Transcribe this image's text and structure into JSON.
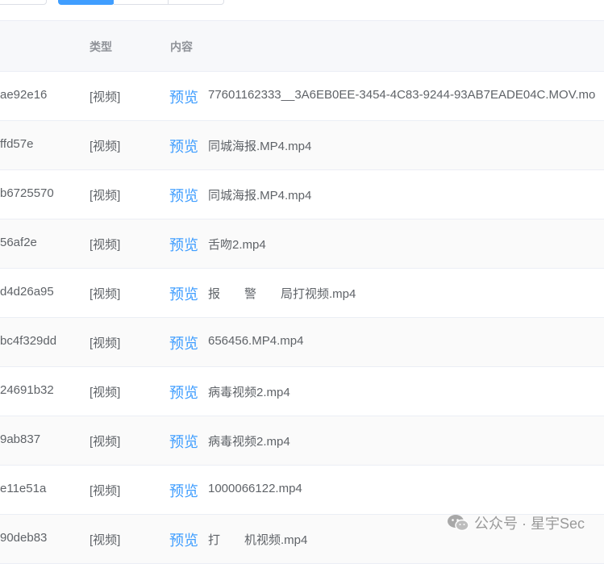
{
  "table": {
    "headers": {
      "type": "类型",
      "content": "内容"
    },
    "preview_label": "预览",
    "rows": [
      {
        "id": "ae92e16",
        "type": "[视频]",
        "file": "77601162333__3A6EB0EE-3454-4C83-9244-93AB7EADE04C.MOV.mo"
      },
      {
        "id": "ffd57e",
        "type": "[视频]",
        "file": "同城海报.MP4.mp4"
      },
      {
        "id": "b6725570",
        "type": "[视频]",
        "file": "同城海报.MP4.mp4"
      },
      {
        "id": "56af2e",
        "type": "[视频]",
        "file": "舌吻2.mp4"
      },
      {
        "id": "d4d26a95",
        "type": "[视频]",
        "file": "报　　警　　局打视频.mp4"
      },
      {
        "id": "bc4f329dd",
        "type": "[视频]",
        "file": "656456.MP4.mp4"
      },
      {
        "id": "24691b32",
        "type": "[视频]",
        "file": "病毒视频2.mp4"
      },
      {
        "id": "9ab837",
        "type": "[视频]",
        "file": "病毒视频2.mp4"
      },
      {
        "id": "e11e51a",
        "type": "[视频]",
        "file": "1000066122.mp4"
      },
      {
        "id": "90deb83",
        "type": "[视频]",
        "file": "打　　机视频.mp4"
      }
    ]
  },
  "watermark": {
    "text": "公众号 · 星宇Sec",
    "icon": "wechat-icon"
  }
}
